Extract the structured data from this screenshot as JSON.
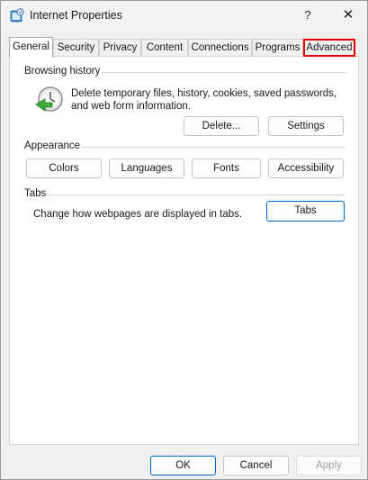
{
  "window": {
    "title": "Internet Properties",
    "help_label": "?",
    "close_label": "✕"
  },
  "tabs": [
    {
      "label": "General",
      "active": true
    },
    {
      "label": "Security"
    },
    {
      "label": "Privacy"
    },
    {
      "label": "Content"
    },
    {
      "label": "Connections"
    },
    {
      "label": "Programs"
    },
    {
      "label": "Advanced",
      "highlighted": true
    }
  ],
  "browsing_history": {
    "title": "Browsing history",
    "description_line1": "Delete temporary files, history, cookies, saved passwords,",
    "description_line2": "and web form information.",
    "delete_label": "Delete...",
    "settings_label": "Settings",
    "icon": "clock-green-arrow-icon"
  },
  "appearance": {
    "title": "Appearance",
    "colors_label": "Colors",
    "languages_label": "Languages",
    "fonts_label": "Fonts",
    "accessibility_label": "Accessibility"
  },
  "tabs_group": {
    "title": "Tabs",
    "description": "Change how webpages are displayed in tabs.",
    "tabs_label": "Tabs"
  },
  "footer": {
    "ok_label": "OK",
    "cancel_label": "Cancel",
    "apply_label": "Apply"
  },
  "colors": {
    "highlight_border": "#e00000",
    "primary_border": "#0067c0"
  }
}
